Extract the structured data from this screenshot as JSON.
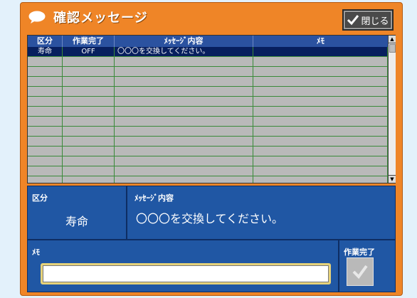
{
  "window": {
    "title": "確認メッセージ",
    "close_label": "閉じる"
  },
  "table": {
    "columns": [
      "区分",
      "作業完了",
      "ﾒｯｾｰｼﾞ内容",
      "ﾒﾓ"
    ],
    "rows": [
      [
        "寿命",
        "OFF",
        "〇〇〇を交換してください。",
        ""
      ]
    ],
    "empty_rows": 13
  },
  "detail": {
    "kubun_label": "区分",
    "kubun_value": "寿命",
    "message_label": "ﾒｯｾｰｼﾞ内容",
    "message_value": "〇〇〇を交換してください。",
    "memo_label": "ﾒﾓ",
    "memo_value": "",
    "done_label": "作業完了"
  },
  "icons": {
    "title": "speech-bubble-icon",
    "close": "checkmark-icon",
    "done": "checkmark-icon"
  },
  "colors": {
    "frame": "#ef8527",
    "panel": "#2057a4",
    "header": "#2b52a0",
    "selected_row": "#071f5e",
    "grid": "#3a8a3a"
  }
}
